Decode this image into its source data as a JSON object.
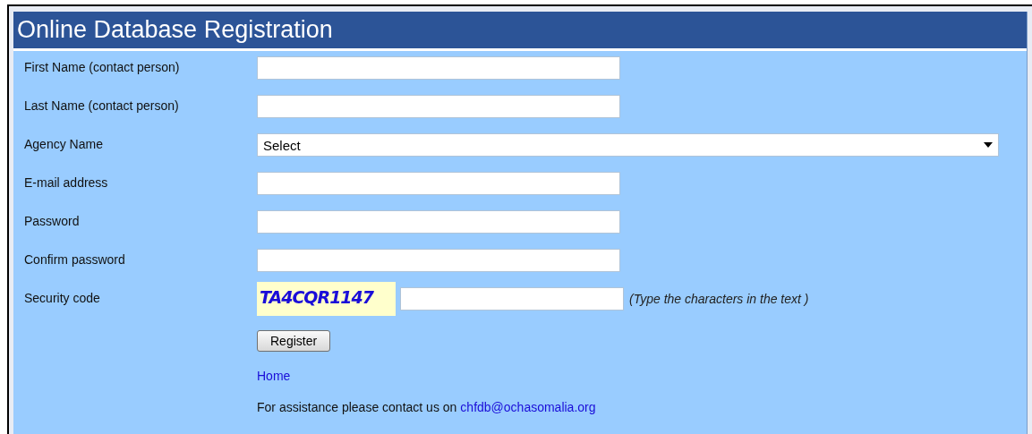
{
  "title": "Online Database Registration",
  "fields": [
    {
      "kind": "text",
      "label": "First Name (contact person)"
    },
    {
      "kind": "text",
      "label": "Last Name (contact person)"
    },
    {
      "kind": "select",
      "label": "Agency Name",
      "value": "Select"
    },
    {
      "kind": "text",
      "label": "E-mail address"
    },
    {
      "kind": "password",
      "label": "Password"
    },
    {
      "kind": "password",
      "label": "Confirm password"
    },
    {
      "kind": "captcha",
      "label": "Security code",
      "code": "TA4CQR1147",
      "hint": "(Type the characters in the text )"
    }
  ],
  "register_button": "Register",
  "home_link": "Home",
  "assistance": {
    "text": "For assistance please contact us on",
    "email": "chfdb@ochasomalia.org"
  }
}
